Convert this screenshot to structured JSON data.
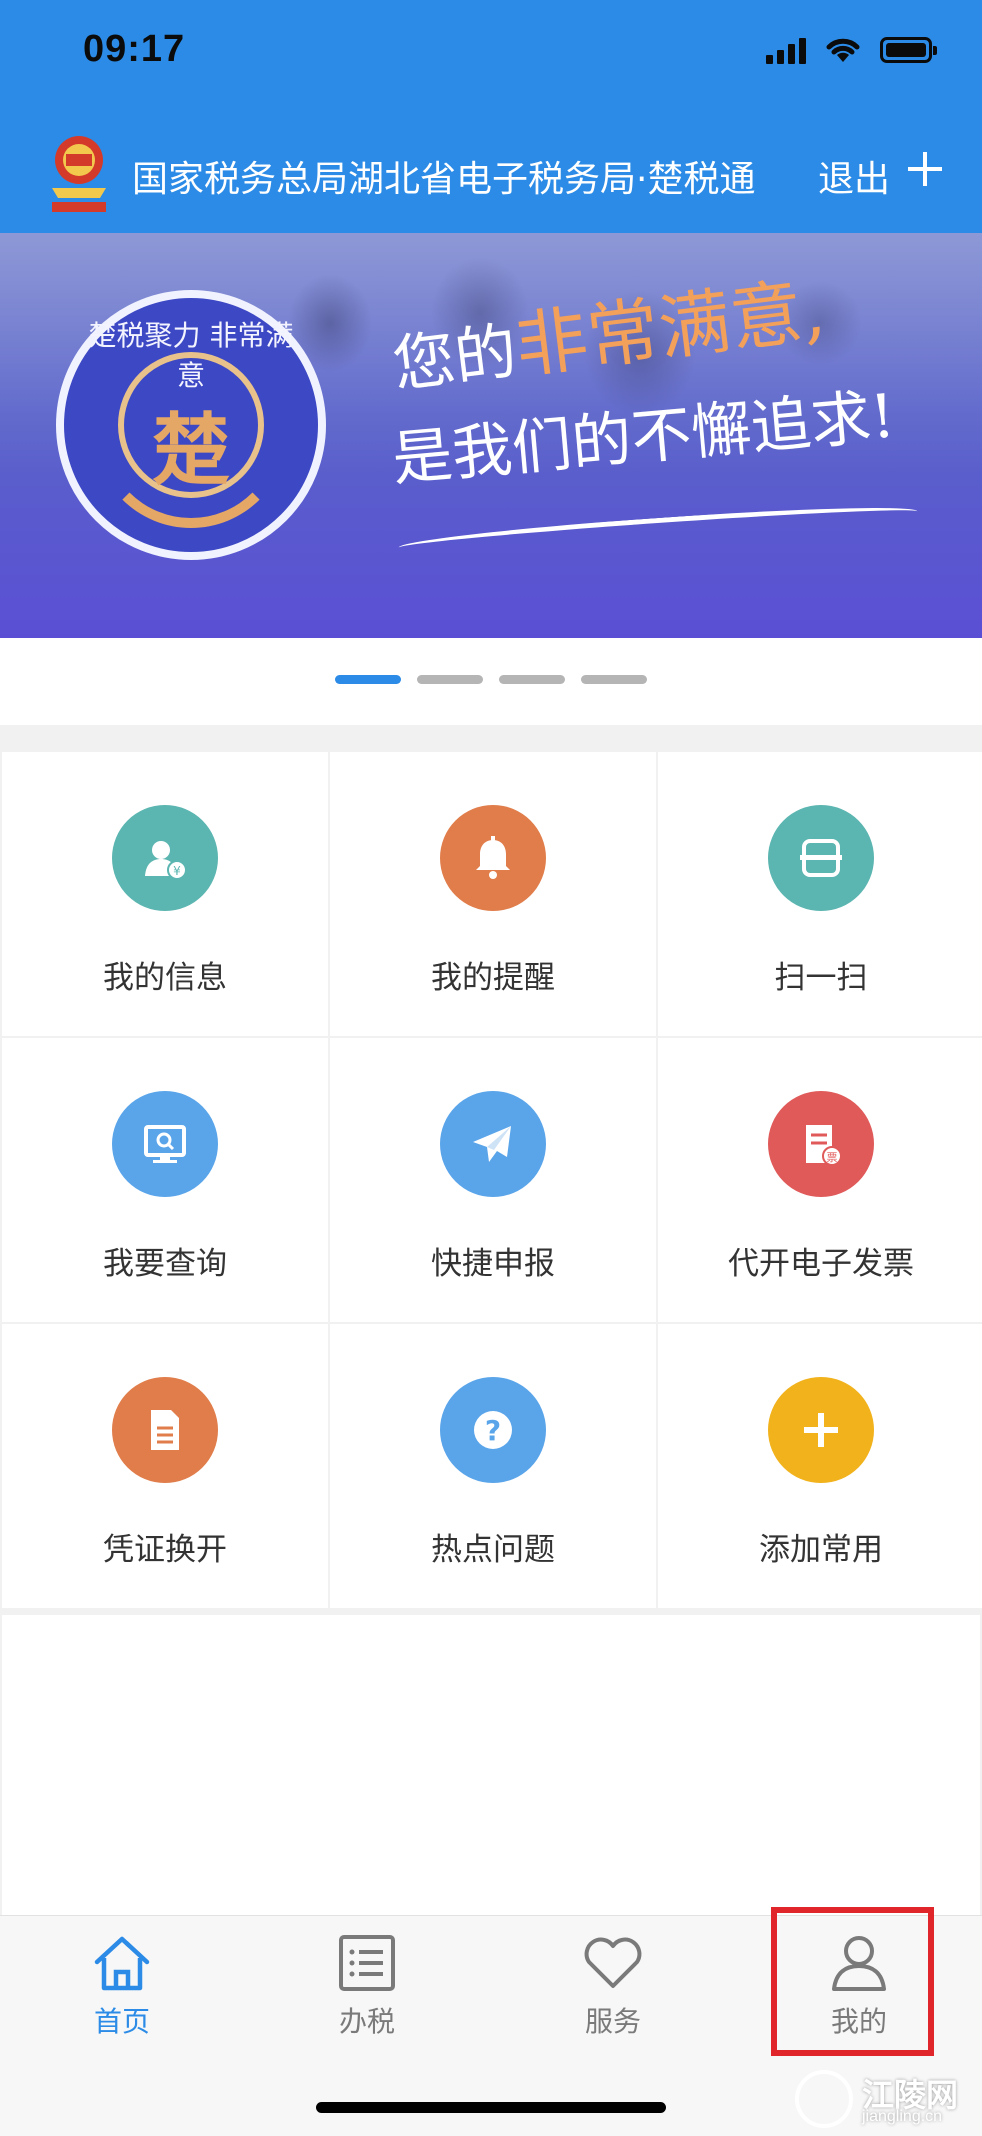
{
  "status_bar": {
    "time": "09:17"
  },
  "header": {
    "title": "国家税务总局湖北省电子税务局·楚税通",
    "logout": "退出"
  },
  "banner": {
    "badge_text": "楚税聚力 非常满意",
    "badge_char": "楚",
    "line1_prefix": "您的",
    "line1_highlight": "非常满意,",
    "line2": "是我们的不懈追求!"
  },
  "carousel": {
    "count": 4,
    "active": 0
  },
  "grid": {
    "items": [
      {
        "label": "我的信息",
        "icon": "user-tax-icon",
        "color": "#5bb5b0"
      },
      {
        "label": "我的提醒",
        "icon": "bell-icon",
        "color": "#e07d4a"
      },
      {
        "label": "扫一扫",
        "icon": "scan-icon",
        "color": "#5bb5b0"
      },
      {
        "label": "我要查询",
        "icon": "monitor-search-icon",
        "color": "#5aa5ea"
      },
      {
        "label": "快捷申报",
        "icon": "paper-plane-icon",
        "color": "#5aa5ea"
      },
      {
        "label": "代开电子发票",
        "icon": "invoice-icon",
        "color": "#e05a5a"
      },
      {
        "label": "凭证换开",
        "icon": "document-icon",
        "color": "#e07d4a"
      },
      {
        "label": "热点问题",
        "icon": "question-icon",
        "color": "#5aa5ea"
      },
      {
        "label": "添加常用",
        "icon": "plus-icon",
        "color": "#f1b21c"
      }
    ]
  },
  "tabbar": {
    "items": [
      {
        "label": "首页",
        "icon": "home-icon",
        "active": true
      },
      {
        "label": "办税",
        "icon": "list-icon",
        "active": false
      },
      {
        "label": "服务",
        "icon": "heart-icon",
        "active": false
      },
      {
        "label": "我的",
        "icon": "person-icon",
        "active": false
      }
    ]
  },
  "watermark": {
    "text": "江陵网",
    "sub": "jiangling.cn"
  },
  "colors": {
    "header_blue": "#2b8be6",
    "highlight_red": "#e0262a"
  }
}
